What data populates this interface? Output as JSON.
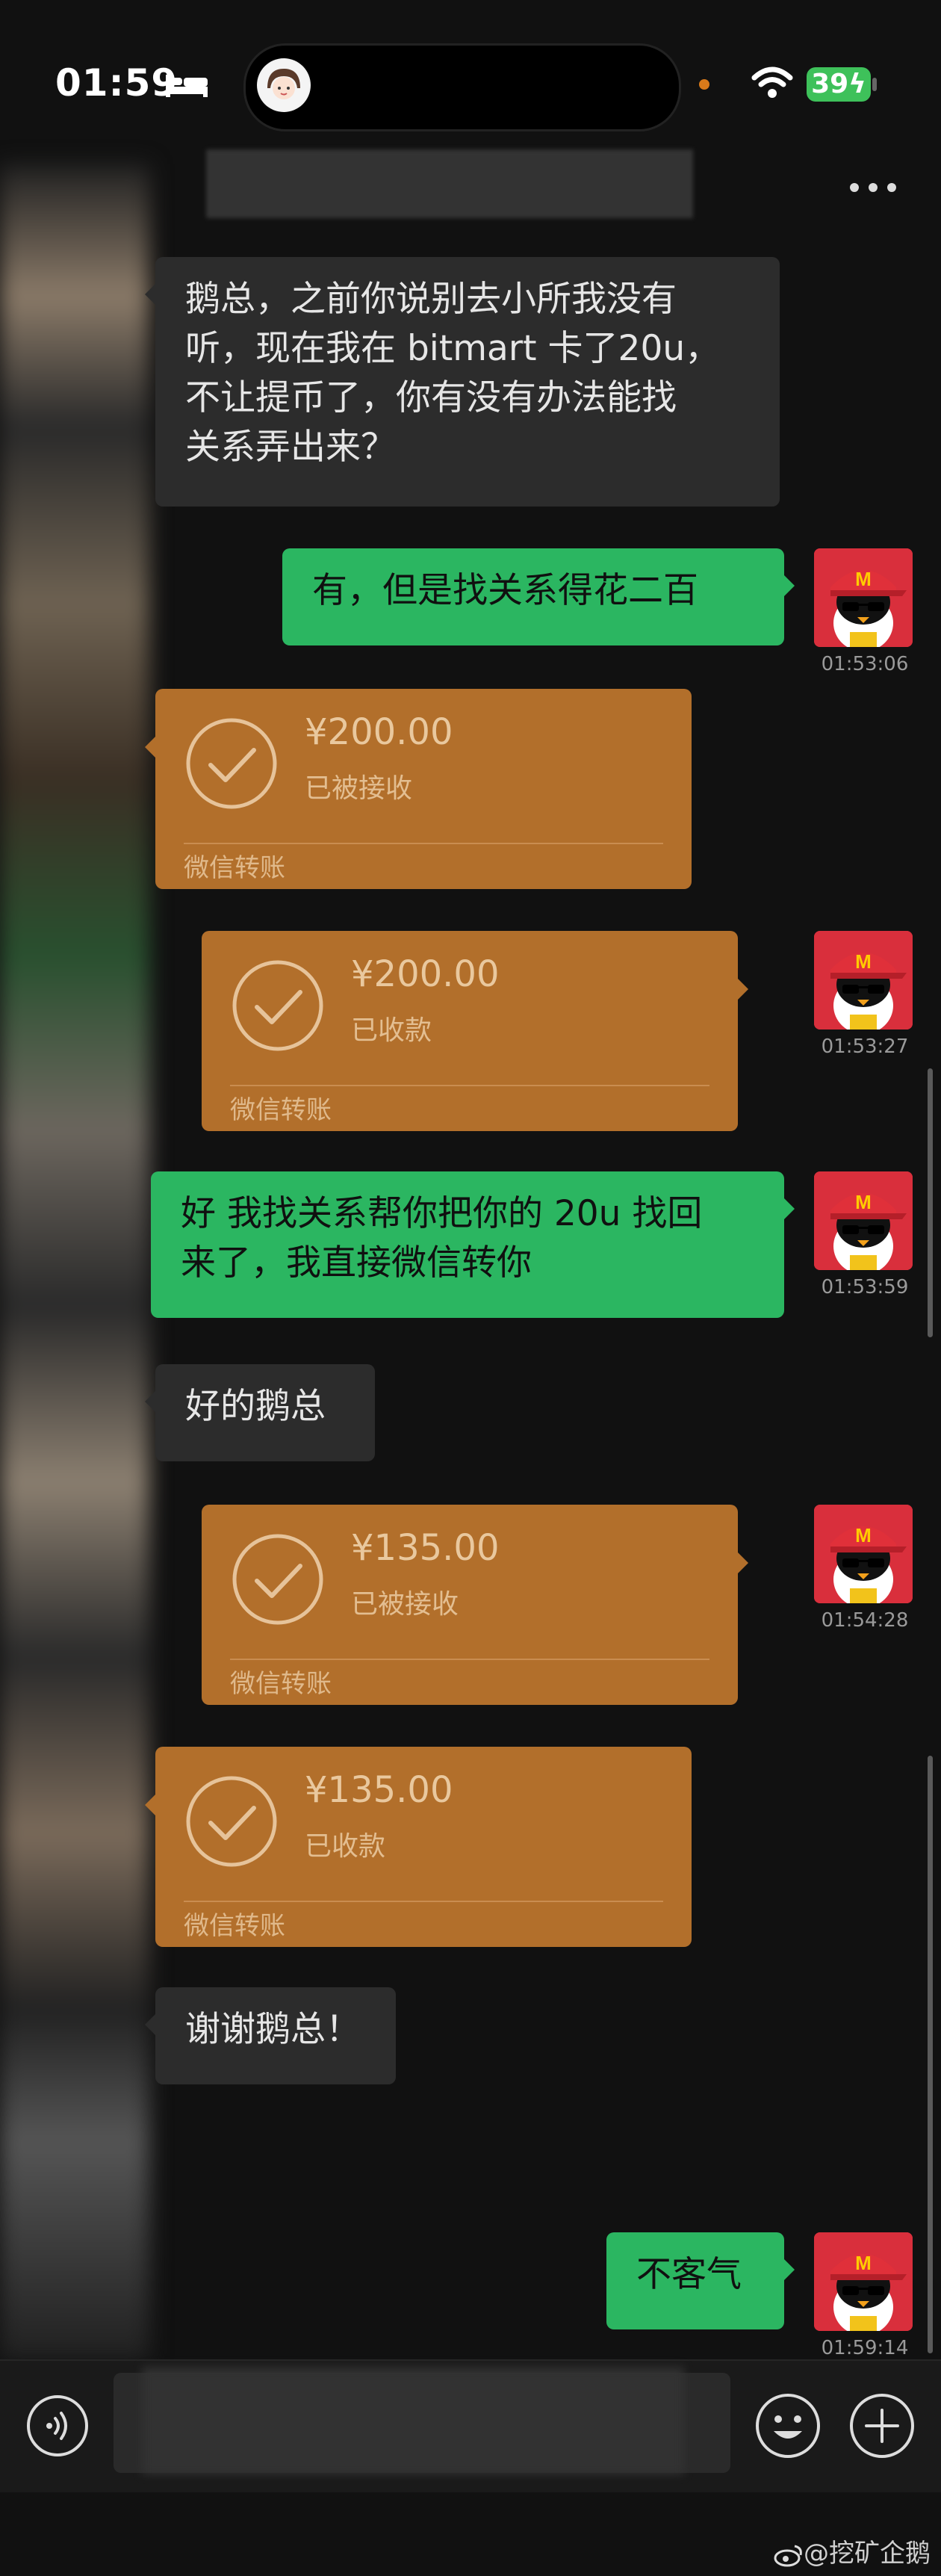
{
  "status_bar": {
    "time": "01:59",
    "battery": "39"
  },
  "messages": [
    {
      "type": "text",
      "side": "in",
      "text": "鹅总，之前你说别去小所我没有\n听，现在我在 bitmart 卡了20u，\n不让提币了，你有没有办法能找\n关系弄出来？"
    },
    {
      "type": "text",
      "side": "out",
      "text": "有，但是找关系得花二百",
      "timestamp": "01:53:06"
    },
    {
      "type": "transfer",
      "side": "in",
      "amount": "¥200.00",
      "status": "已被接收",
      "label": "微信转账"
    },
    {
      "type": "transfer",
      "side": "out",
      "amount": "¥200.00",
      "status": "已收款",
      "label": "微信转账",
      "timestamp": "01:53:27"
    },
    {
      "type": "text",
      "side": "out",
      "text": "好 我找关系帮你把你的 20u 找回\n来了，我直接微信转你",
      "timestamp": "01:53:59"
    },
    {
      "type": "text",
      "side": "in",
      "text": "好的鹅总"
    },
    {
      "type": "transfer",
      "side": "out",
      "amount": "¥135.00",
      "status": "已被接收",
      "label": "微信转账",
      "timestamp": "01:54:28"
    },
    {
      "type": "transfer",
      "side": "in",
      "amount": "¥135.00",
      "status": "已收款",
      "label": "微信转账"
    },
    {
      "type": "text",
      "side": "in",
      "text": "谢谢鹅总！"
    },
    {
      "type": "text",
      "side": "out",
      "text": "不客气",
      "timestamp": "01:59:14"
    }
  ],
  "watermark": "@挖矿企鹅",
  "colors": {
    "background": "#111111",
    "incoming": "#2c2c2c",
    "outgoing": "#2bb661",
    "transfer": "#b26f2b"
  }
}
